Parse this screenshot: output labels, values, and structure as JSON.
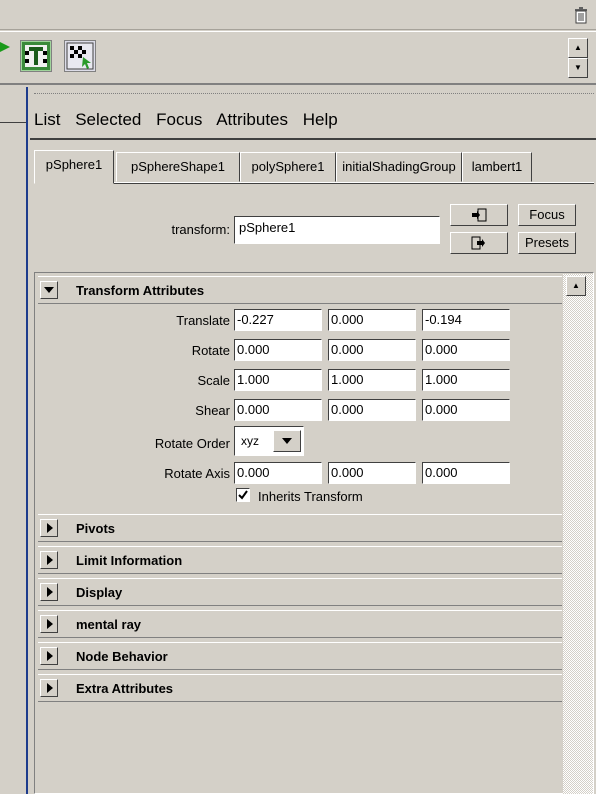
{
  "menu": [
    "List",
    "Selected",
    "Focus",
    "Attributes",
    "Help"
  ],
  "tabs": [
    "pSphere1",
    "pSphereShape1",
    "polySphere1",
    "initialShadingGroup",
    "lambert1"
  ],
  "active_tab": 0,
  "node": {
    "type_label": "transform:",
    "name": "pSphere1"
  },
  "buttons": {
    "focus": "Focus",
    "presets": "Presets"
  },
  "transform_section": {
    "title": "Transform Attributes",
    "expanded": true,
    "rows": [
      {
        "label": "Translate",
        "values": [
          "-0.227",
          "0.000",
          "-0.194"
        ]
      },
      {
        "label": "Rotate",
        "values": [
          "0.000",
          "0.000",
          "0.000"
        ]
      },
      {
        "label": "Scale",
        "values": [
          "1.000",
          "1.000",
          "1.000"
        ]
      },
      {
        "label": "Shear",
        "values": [
          "0.000",
          "0.000",
          "0.000"
        ]
      }
    ],
    "rotate_order": {
      "label": "Rotate Order",
      "value": "xyz"
    },
    "rotate_axis": {
      "label": "Rotate Axis",
      "values": [
        "0.000",
        "0.000",
        "0.000"
      ]
    },
    "inherits": {
      "label": "Inherits Transform",
      "checked": true
    }
  },
  "collapsed_sections": [
    "Pivots",
    "Limit Information",
    "Display",
    "mental ray",
    "Node Behavior",
    "Extra Attributes"
  ],
  "icons": {
    "trash": "trash-icon",
    "shelf_1": "joint-tool-icon",
    "shelf_2": "paint-tool-icon",
    "expand": "triangle-down-icon",
    "collapse": "triangle-right-icon"
  }
}
